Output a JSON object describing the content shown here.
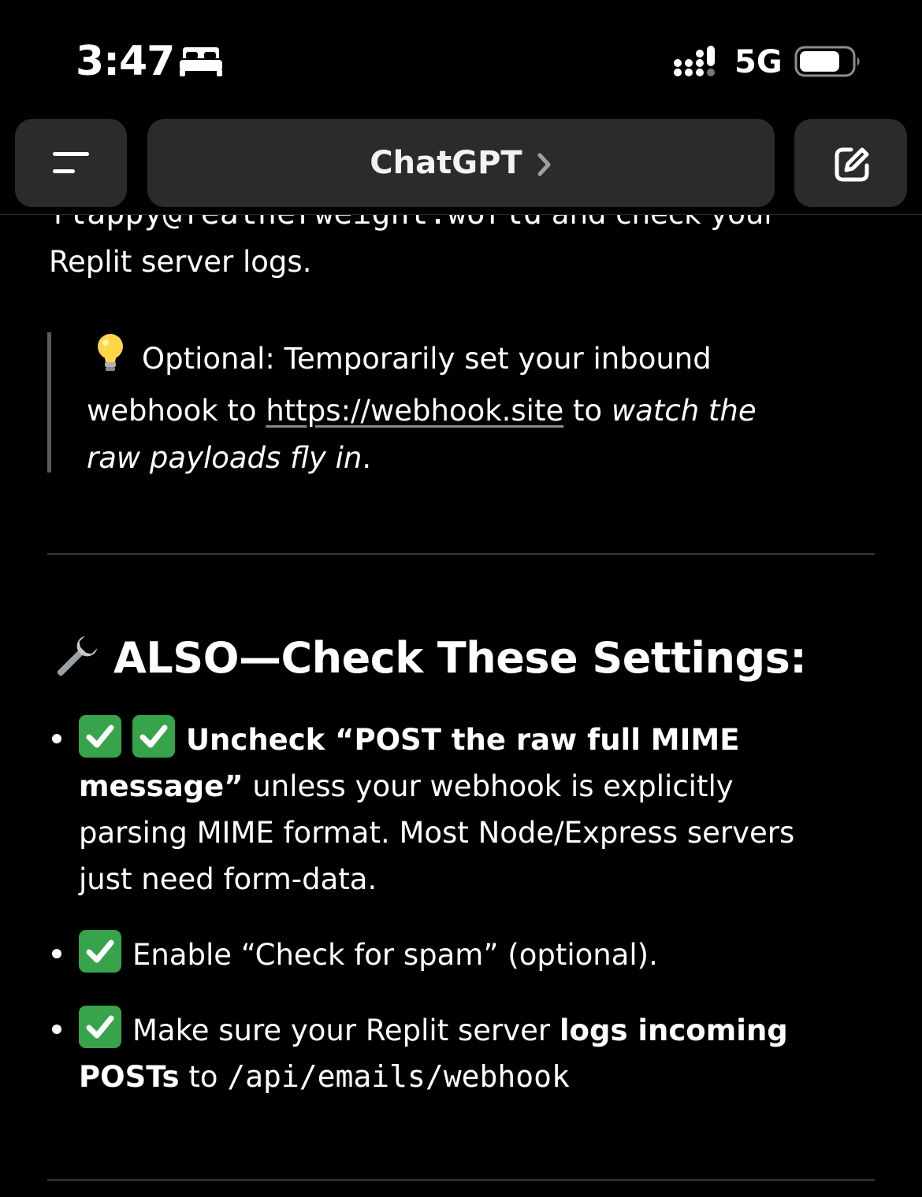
{
  "status_bar": {
    "time": "3:47",
    "network": "5G",
    "icons": [
      "bed-icon",
      "signal-icon",
      "battery-icon"
    ]
  },
  "nav": {
    "title": "ChatGPT",
    "menu_icon": "menu-icon",
    "compose_icon": "compose-icon",
    "chevron_icon": "chevron-right-icon"
  },
  "message": {
    "cut_line_mono": "flappy@featherweight.world",
    "cut_line_text": " and check your",
    "logs_line": "Replit server logs.",
    "quote": {
      "emoji": "💡",
      "prefix": "Optional: Temporarily set your inbound",
      "line2_text": "webhook to ",
      "link": "https://webhook.site",
      "mid": " to ",
      "italic_1": "watch the",
      "italic_2": "raw payloads fly in",
      "end": "."
    },
    "section_heading": "ALSO—Check These Settings:",
    "items": [
      {
        "bold_a": "Uncheck “POST the raw full MIME",
        "bold_b": "message”",
        "text_b": " unless your webhook is explicitly",
        "text_c": "parsing MIME format. Most Node/Express servers",
        "text_d": "just need form-data."
      },
      {
        "text": "Enable “Check for spam” (optional)."
      },
      {
        "text_a": "Make sure your Replit server ",
        "bold_a": "logs incoming",
        "bold_b": "POSTs",
        "text_b": " to ",
        "code": "/api/emails/webhook"
      }
    ]
  },
  "colors": {
    "background": "#000000",
    "nav_button": "#2b2b2d",
    "check_green": "#37a34a",
    "divider": "#2e2e2e",
    "quote_bar": "#5c5c5c"
  }
}
